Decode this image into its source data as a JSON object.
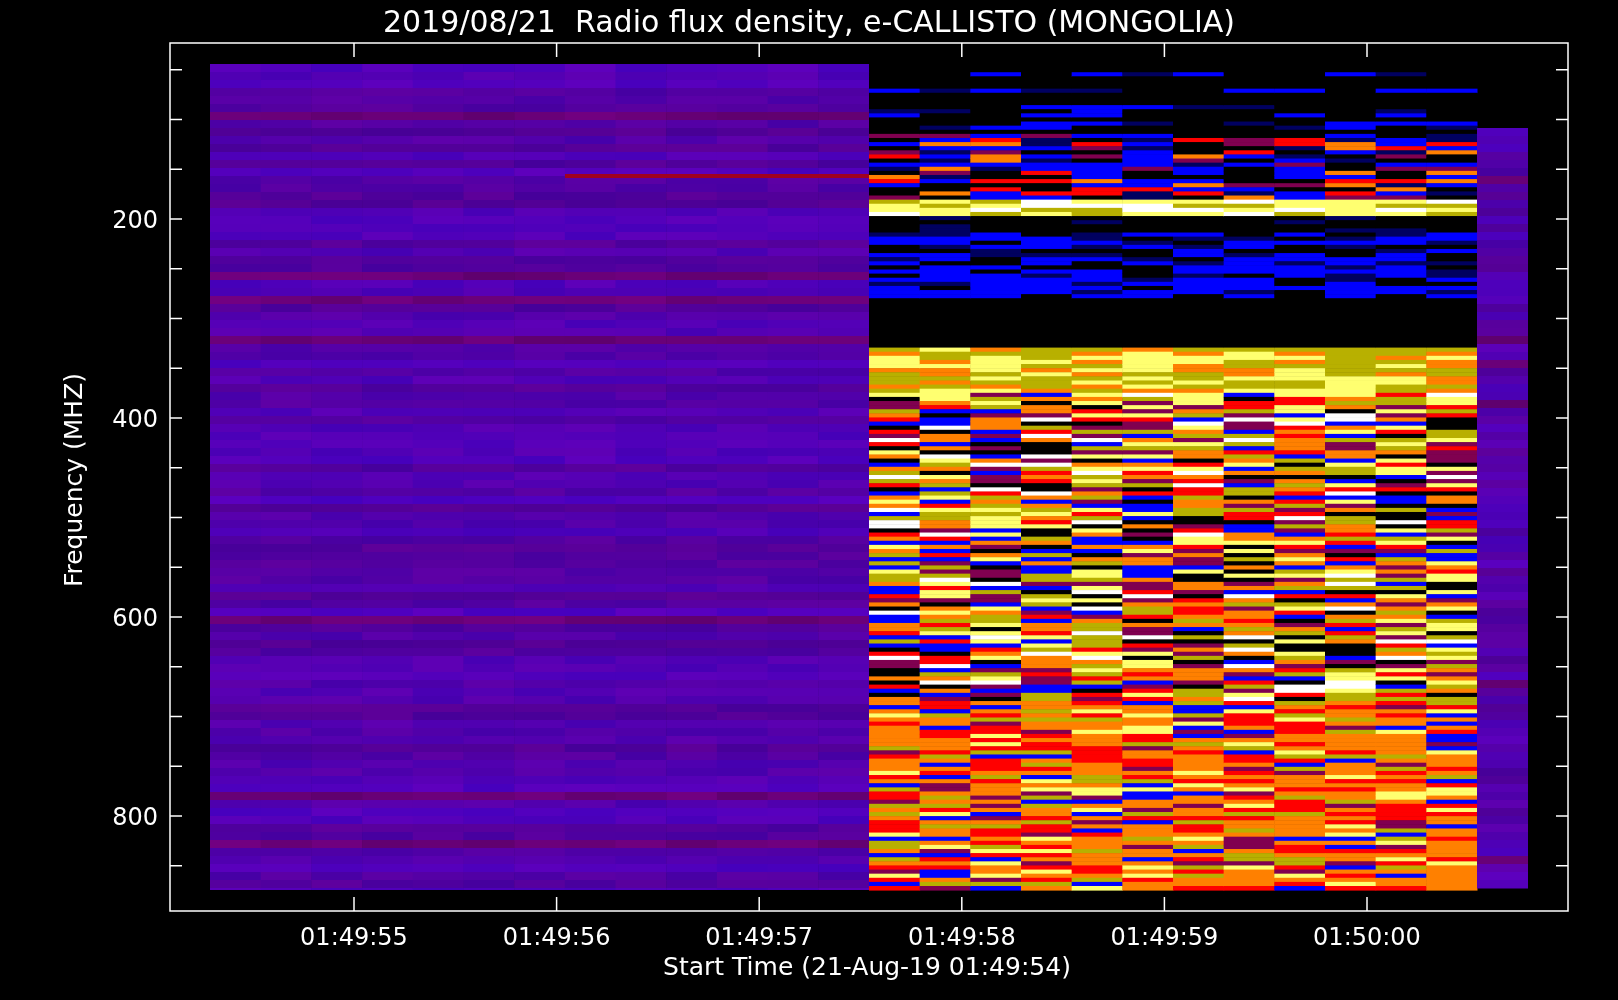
{
  "title": "2019/08/21  Radio flux density, e-CALLISTO (MONGOLIA)",
  "y_axis": {
    "label": "Frequency (MHZ)",
    "ticks": [
      "200",
      "400",
      "600",
      "800"
    ]
  },
  "x_axis": {
    "label": "Start Time (21-Aug-19 01:49:54)",
    "ticks": [
      "01:49:55",
      "01:49:56",
      "01:49:57",
      "01:49:58",
      "01:49:59",
      "01:50:00"
    ]
  }
}
